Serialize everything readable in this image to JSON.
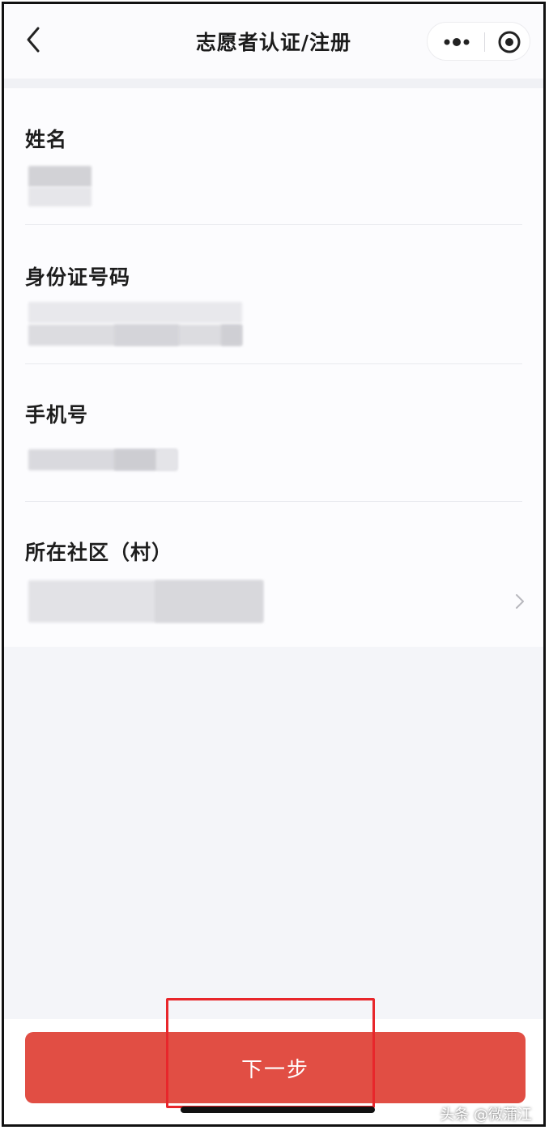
{
  "navbar": {
    "title": "志愿者认证/注册"
  },
  "form": {
    "fields": [
      {
        "label": "姓名",
        "value": ""
      },
      {
        "label": "身份证号码",
        "value": ""
      },
      {
        "label": "手机号",
        "value": ""
      },
      {
        "label": "所在社区（村）",
        "value": ""
      }
    ]
  },
  "footer": {
    "next_label": "下一步"
  },
  "watermark": "头条 @微蒲江",
  "colors": {
    "accent": "#e14e44",
    "highlight": "#e8262b"
  }
}
